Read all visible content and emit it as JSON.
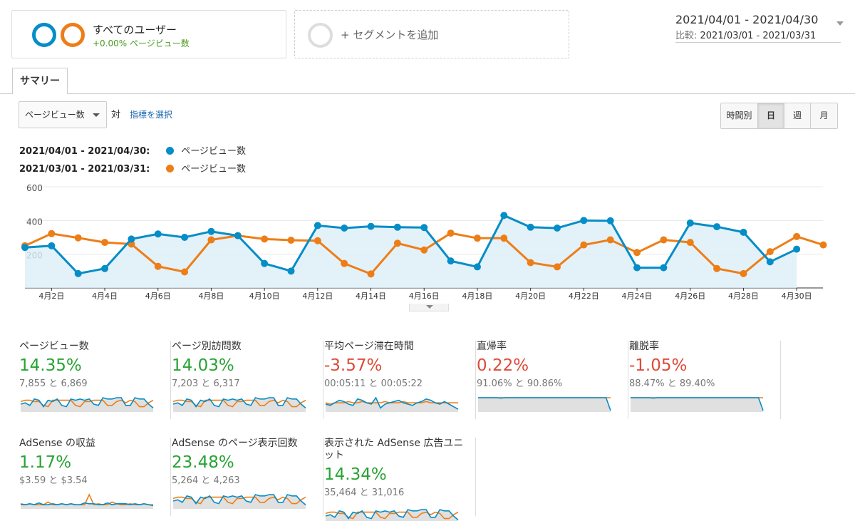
{
  "segment": {
    "name": "すべてのユーザー",
    "stat": "+0.00% ページビュー数",
    "add_label": "+ セグメントを追加",
    "colors": [
      "#058dc7",
      "#ed7e17"
    ]
  },
  "date_range": {
    "main": "2021/04/01 - 2021/04/30",
    "compare_label": "比較: ",
    "compare": "2021/03/01 - 2021/03/31"
  },
  "tabs": [
    "サマリー"
  ],
  "controls": {
    "metric": "ページビュー数",
    "vs": "対",
    "pick_metric": "指標を選択",
    "granularity": [
      "時間別",
      "日",
      "週",
      "月"
    ],
    "active_granularity": "日"
  },
  "legend": [
    {
      "range": "2021/04/01 - 2021/04/30:",
      "name": "ページビュー数",
      "color": "#058dc7"
    },
    {
      "range": "2021/03/01 - 2021/03/31:",
      "name": "ページビュー数",
      "color": "#ed7e17"
    }
  ],
  "chart_data": {
    "type": "line",
    "title": "",
    "xlabel": "",
    "ylabel": "",
    "ylim": [
      0,
      600
    ],
    "yticks": [
      "600",
      "400",
      "200"
    ],
    "x_labels": [
      "4月2日",
      "4月4日",
      "4月6日",
      "4月8日",
      "4月10日",
      "4月12日",
      "4月14日",
      "4月16日",
      "4月18日",
      "4月20日",
      "4月22日",
      "4月24日",
      "4月26日",
      "4月28日",
      "4月30日"
    ],
    "series": [
      {
        "name": "2021/04/01 - 2021/04/30",
        "color": "#058dc7",
        "fill": true,
        "values": [
          240,
          250,
          85,
          115,
          290,
          320,
          300,
          335,
          310,
          145,
          100,
          370,
          355,
          365,
          360,
          358,
          160,
          125,
          430,
          360,
          355,
          400,
          398,
          120,
          120,
          385,
          363,
          330,
          155,
          230
        ]
      },
      {
        "name": "2021/03/01 - 2021/03/31",
        "color": "#ed7e17",
        "fill": false,
        "values": [
          250,
          322,
          297,
          270,
          260,
          128,
          95,
          285,
          310,
          290,
          283,
          280,
          145,
          83,
          265,
          225,
          325,
          295,
          295,
          150,
          125,
          255,
          285,
          210,
          285,
          270,
          115,
          85,
          215,
          305,
          255
        ]
      }
    ]
  },
  "scorecards": [
    {
      "title": "ページビュー数",
      "value": "14.35%",
      "trend": "up",
      "detail": "7,855 と 6,869",
      "spark": "volatile"
    },
    {
      "title": "ページ別訪問数",
      "value": "14.03%",
      "trend": "up",
      "detail": "7,203 と 6,317",
      "spark": "volatile"
    },
    {
      "title": "平均ページ滞在時間",
      "value": "-3.57%",
      "trend": "down",
      "detail": "00:05:11 と 00:05:22",
      "spark": "mixed"
    },
    {
      "title": "直帰率",
      "value": "0.22%",
      "trend": "down",
      "detail": "91.06% と 90.86%",
      "spark": "flat"
    },
    {
      "title": "離脱率",
      "value": "-1.05%",
      "trend": "down",
      "detail": "88.47% と 89.40%",
      "spark": "flat"
    },
    {
      "title": "AdSense の収益",
      "value": "1.17%",
      "trend": "up",
      "detail": "$3.59 と $3.54",
      "spark": "spiky"
    },
    {
      "title": "AdSense のページ表示回数",
      "value": "23.48%",
      "trend": "up",
      "detail": "5,264 と 4,263",
      "spark": "volatile"
    },
    {
      "title": "表示された AdSense 広告ユニット",
      "value": "14.34%",
      "trend": "up",
      "detail": "35,464 と 31,016",
      "spark": "volatile"
    }
  ]
}
